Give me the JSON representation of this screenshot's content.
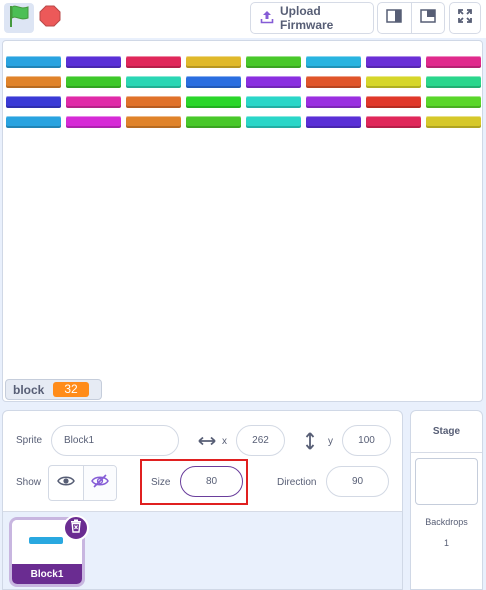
{
  "toolbar": {
    "upload_label": "Upload Firmware",
    "flag_color": "#4cbf56",
    "stop_color": "#ec5959"
  },
  "stage": {
    "brick_colors": [
      [
        "#29a3e0",
        "#5a2fd6",
        "#e0285a",
        "#e0b92a",
        "#49c82a",
        "#29b4e0",
        "#6a2fd6",
        "#e02a8c"
      ],
      [
        "#e0832a",
        "#3ec82a",
        "#2ad6b4",
        "#2a6ee0",
        "#8a2fe0",
        "#e0552a",
        "#d6d62a",
        "#2ad68c"
      ],
      [
        "#3a3ad6",
        "#e02aa8",
        "#e0722a",
        "#2ad62a",
        "#2ad6c8",
        "#9a2fe0",
        "#e0382a",
        "#5ad62a"
      ],
      [
        "#29a3e0",
        "#d62ad6",
        "#e0832a",
        "#49c82a",
        "#2ad6c8",
        "#5a2fd6",
        "#e0285a",
        "#d6c82a"
      ]
    ],
    "monitor": {
      "label": "block",
      "value": "32",
      "value_color": "#ff8c1a"
    }
  },
  "sprite_info": {
    "sprite_label": "Sprite",
    "sprite_name": "Block1",
    "x_label": "x",
    "x_value": "262",
    "y_label": "y",
    "y_value": "100",
    "show_label": "Show",
    "size_label": "Size",
    "size_value": "80",
    "direction_label": "Direction",
    "direction_value": "90"
  },
  "sprite_list": {
    "sprites": [
      {
        "name": "Block1",
        "selected": true,
        "thumb_color": "#29a8e0"
      }
    ],
    "selected_color": "#6a2c91"
  },
  "stage_target": {
    "title": "Stage",
    "backdrops_label": "Backdrops",
    "backdrops_count": "1"
  }
}
